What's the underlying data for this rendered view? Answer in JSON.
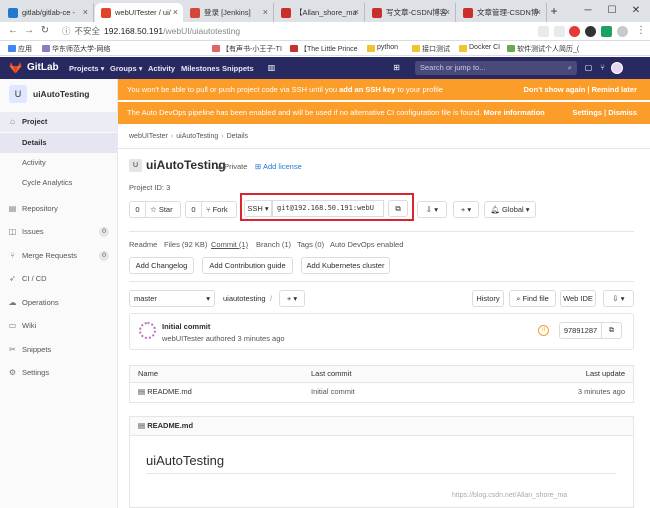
{
  "browser": {
    "tabs": [
      {
        "label": "gitlab/gitlab-ce -"
      },
      {
        "label": "webUITester / ui/"
      },
      {
        "label": "登录 [Jenkins]"
      },
      {
        "label": "【Allan_shore_ma"
      },
      {
        "label": "写文章-CSDN博客"
      },
      {
        "label": "文章管理-CSDN博"
      }
    ],
    "new_tab": "+",
    "insecure": "不安全",
    "url_host": "192.168.50.191",
    "url_path": "/webUI/uiautotesting",
    "bookmarks": [
      "应用",
      "华东师范大学-网络",
      "【有声书-小王子-TI",
      "【The Little Prince",
      "python",
      "接口测试",
      "Docker CI",
      "软件测试个人简历_("
    ]
  },
  "nav": {
    "brand": "GitLab",
    "menus": [
      "Projects ▾",
      "Groups ▾",
      "Activity",
      "Milestones",
      "Snippets"
    ],
    "search_placeholder": "Search or jump to..."
  },
  "sidebar": {
    "project_initial": "U",
    "project_name": "uiAutoTesting",
    "project": "Project",
    "sub": [
      "Details",
      "Activity",
      "Cycle Analytics"
    ],
    "items": [
      {
        "label": "Repository",
        "count": ""
      },
      {
        "label": "Issues",
        "count": "0"
      },
      {
        "label": "Merge Requests",
        "count": "0"
      },
      {
        "label": "CI / CD",
        "count": ""
      },
      {
        "label": "Operations",
        "count": ""
      },
      {
        "label": "Wiki",
        "count": ""
      },
      {
        "label": "Snippets",
        "count": ""
      },
      {
        "label": "Settings",
        "count": ""
      }
    ]
  },
  "alerts": {
    "ssh_prefix": "You won't be able to pull or push project code via SSH until you ",
    "ssh_link": "add an SSH key",
    "ssh_suffix": " to your profile",
    "ssh_actions": "Don't show again | Remind later",
    "devops_msg": "The Auto DevOps pipeline has been enabled and will be used if no alternative CI configuration file is found. ",
    "devops_link": "More information",
    "devops_actions": "Settings | Dismiss"
  },
  "breadcrumb": [
    "webUITester",
    "uiAutoTesting",
    "Details"
  ],
  "project": {
    "initial": "U",
    "name": "uiAutoTesting",
    "visibility": "Private",
    "add_license": "Add license",
    "id_text": "Project ID: 3",
    "star_count": "0",
    "star_label": "Star",
    "fork_count": "0",
    "fork_label": "Fork",
    "clone_protocol": "SSH ▾",
    "clone_url": "git@192.168.50.191:webU",
    "notify_label": "Global ▾"
  },
  "stats": [
    "Readme",
    "Files (92 KB)",
    "Commit (1)",
    "Branch (1)",
    "Tags (0)",
    "Auto DevOps enabled"
  ],
  "add_buttons": [
    "Add Changelog",
    "Add Contribution guide",
    "Add Kubernetes cluster"
  ],
  "tree": {
    "branch": "master",
    "path": "uiautotesting",
    "sep": "/",
    "history": "History",
    "find_file": "Find file",
    "web_ide": "Web IDE"
  },
  "commit": {
    "title": "Initial commit",
    "meta": "webUITester authored 3 minutes ago",
    "pipeline": "II",
    "sha": "97891287"
  },
  "files": {
    "headers": [
      "Name",
      "Last commit",
      "Last update"
    ],
    "rows": [
      {
        "name": "README.md",
        "commit": "Initial commit",
        "updated": "3 minutes ago"
      }
    ]
  },
  "readme": {
    "file": "README.md",
    "heading": "uiAutoTesting"
  },
  "watermark": "https://blog.csdn.net/Allan_shore_ma"
}
